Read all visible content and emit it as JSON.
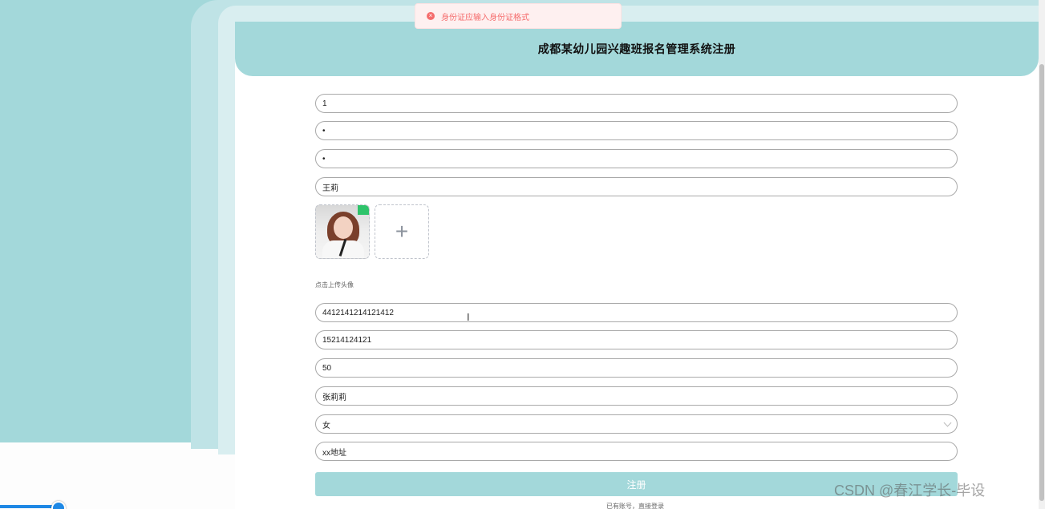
{
  "toast": {
    "icon": "error-circle-icon",
    "message": "身份证应输入身份证格式",
    "color": "#f56c6c"
  },
  "header": {
    "title": "成都某幼儿园兴趣班报名管理系统注册"
  },
  "form": {
    "account": "1",
    "password": "•",
    "confirm_password": "•",
    "name": "王莉",
    "avatar_hint": "点击上传头像",
    "upload_icon": "plus-icon",
    "id_card": "4412141214121412",
    "phone": "15214124121",
    "age": "50",
    "child_name": "张莉莉",
    "gender": "女",
    "address": "xx地址"
  },
  "actions": {
    "submit_label": "注册",
    "login_link": "已有账号，直接登录"
  },
  "watermark": "CSDN @春江学长-毕设",
  "colors": {
    "accent": "#a3d8da",
    "error": "#f56c6c"
  }
}
